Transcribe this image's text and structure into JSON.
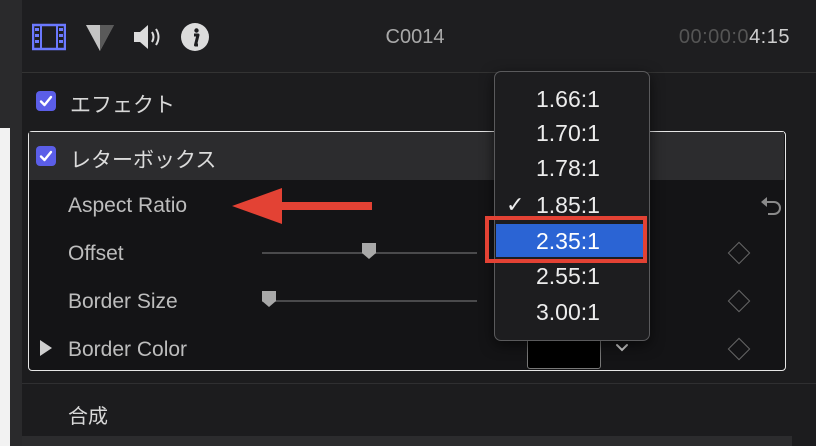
{
  "header": {
    "icons": [
      "film-icon",
      "color-icon",
      "audio-icon",
      "info-icon"
    ],
    "clip_name": "C0014",
    "timecode_dim": "00:00:0",
    "timecode_bright": "4:15"
  },
  "effects": {
    "label": "エフェクト",
    "checked": true
  },
  "letterbox": {
    "label": "レターボックス",
    "checked": true,
    "params": {
      "aspect_ratio": "Aspect Ratio",
      "offset": "Offset",
      "border_size": "Border Size",
      "border_color": "Border Color"
    },
    "offset_slider_value": 0.47,
    "border_size_slider_value": 0.0
  },
  "aspect_menu": {
    "options": [
      "1.66:1",
      "1.70:1",
      "1.78:1",
      "1.85:1",
      "2.35:1",
      "2.55:1",
      "3.00:1"
    ],
    "checked_option": "1.85:1",
    "highlighted_option": "2.35:1",
    "check_glyph": "✓"
  },
  "compositing": {
    "label": "合成"
  },
  "colors": {
    "accent_checkbox": "#5b5ee8",
    "menu_highlight": "#2b64d4",
    "annotation_red": "#e34234"
  }
}
